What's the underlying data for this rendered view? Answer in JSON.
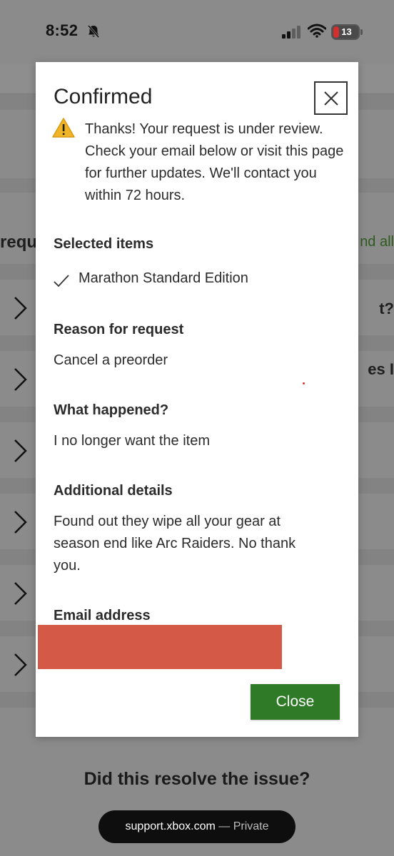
{
  "status_bar": {
    "time": "8:52",
    "battery": "13",
    "icons": [
      "bell-muted-icon",
      "signal-icon",
      "wifi-icon",
      "battery-icon"
    ]
  },
  "background_page": {
    "left_cut_text": "requ",
    "right_cut_text": "nd all",
    "row_fragments": [
      "t?",
      "es I"
    ],
    "question": "Did this resolve the issue?",
    "url": "support.xbox.com",
    "url_suffix": " — Private"
  },
  "modal": {
    "title": "Confirmed",
    "notice": "Thanks! Your request is under review. Check your email below or visit this page for further updates. We'll contact you within 72 hours.",
    "selected_items_label": "Selected items",
    "selected_items": [
      "Marathon Standard Edition"
    ],
    "reason_label": "Reason for request",
    "reason_value": "Cancel a preorder",
    "what_happened_label": "What happened?",
    "what_happened_value": "I no longer want the item",
    "details_label": "Additional details",
    "details_value": "Found out they wipe all your gear at season end like Arc Raiders. No thank you.",
    "email_label": "Email address",
    "close_button": "Close"
  },
  "colors": {
    "accent_green": "#2e7a27",
    "warning_yellow": "#f0b429",
    "redaction": "#d45a47"
  }
}
